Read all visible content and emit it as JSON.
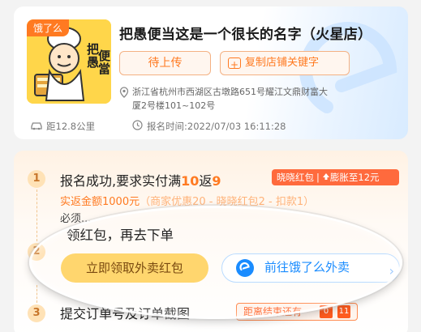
{
  "shop": {
    "badge": "饿了么",
    "name": "把愚便当这是一个很长的名字（火星店）",
    "status_button": "待上传",
    "copy_keyword_button": "复制店铺关键字",
    "address": "浙江省杭州市西湖区古墩路651号耀江文鼎财富大厦2号楼101~102号",
    "distance": "距12.8公里",
    "signup_time": "报名时间:2022/07/03 16:11:28",
    "logo_text": "把愚便當"
  },
  "steps": [
    {
      "number": "1",
      "title_prefix": "报名成功,要求实付满",
      "title_amount": "10",
      "title_mid": "返",
      "title_rebate": "9",
      "tag_left": "晓晓红包",
      "tag_right": "膨胀至12元",
      "detail_prefix": "实返金额1000元",
      "detail_faded": "（商家优惠20 - 晓晓红包2 - 扣款1）",
      "note": "必须..."
    },
    {
      "number": "2",
      "title": "领红包，再去下单",
      "claim_button": "立即领取外卖红包",
      "eleme_button": "前往饿了么外卖",
      "chevron": "›"
    },
    {
      "number": "3",
      "title": "提交订单号及订单截图",
      "countdown_label": "距离结束还有",
      "countdown_digits": [
        "0",
        "11"
      ]
    }
  ],
  "colors": {
    "accent": "#ff7a21",
    "blue": "#1a8cff",
    "yellow": "#ffd66e"
  }
}
